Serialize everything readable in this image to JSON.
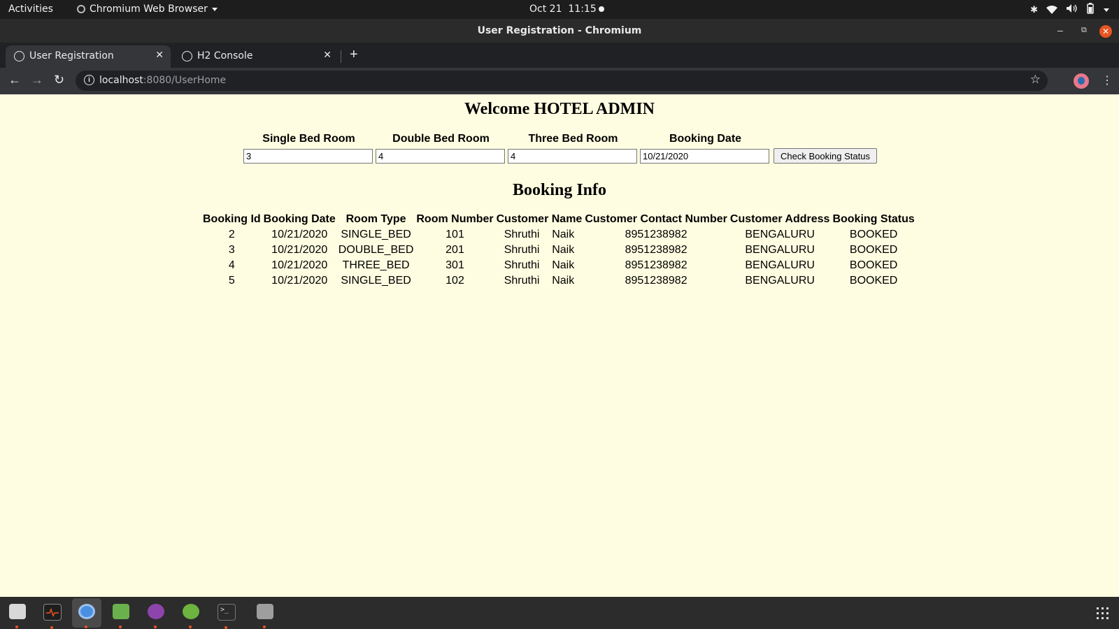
{
  "topbar": {
    "activities": "Activities",
    "app_name": "Chromium Web Browser",
    "date": "Oct 21",
    "time": "11:15"
  },
  "window": {
    "title": "User Registration - Chromium"
  },
  "tabs": [
    {
      "label": "User Registration",
      "active": true
    },
    {
      "label": "H2 Console",
      "active": false
    }
  ],
  "omnibox": {
    "host": "localhost",
    "path": ":8080/UserHome"
  },
  "page": {
    "welcome": "Welcome HOTEL ADMIN",
    "form": {
      "fields": [
        {
          "label": "Single Bed Room",
          "value": "3"
        },
        {
          "label": "Double Bed Room",
          "value": "4"
        },
        {
          "label": "Three Bed Room",
          "value": "4"
        },
        {
          "label": "Booking Date",
          "value": "10/21/2020"
        }
      ],
      "button": "Check Booking Status"
    },
    "booking_title": "Booking Info",
    "table": {
      "columns": [
        "Booking Id",
        "Booking Date",
        "Room Type",
        "Room Number",
        "Customer Name",
        "Customer Contact Number",
        "Customer Address",
        "Booking Status"
      ],
      "rows": [
        {
          "id": "2",
          "date": "10/21/2020",
          "type": "SINGLE_BED",
          "room": "101",
          "first": "Shruthi",
          "last": "Naik",
          "contact": "8951238982",
          "address": "BENGALURU",
          "status": "BOOKED"
        },
        {
          "id": "3",
          "date": "10/21/2020",
          "type": "DOUBLE_BED",
          "room": "201",
          "first": "Shruthi",
          "last": "Naik",
          "contact": "8951238982",
          "address": "BENGALURU",
          "status": "BOOKED"
        },
        {
          "id": "4",
          "date": "10/21/2020",
          "type": "THREE_BED",
          "room": "301",
          "first": "Shruthi",
          "last": "Naik",
          "contact": "8951238982",
          "address": "BENGALURU",
          "status": "BOOKED"
        },
        {
          "id": "5",
          "date": "10/21/2020",
          "type": "SINGLE_BED",
          "room": "102",
          "first": "Shruthi",
          "last": "Naik",
          "contact": "8951238982",
          "address": "BENGALURU",
          "status": "BOOKED"
        }
      ]
    }
  },
  "dock": {
    "apps": [
      "files-icon",
      "system-monitor-icon",
      "chromium-icon",
      "image-editor-icon",
      "github-icon",
      "spring-icon",
      "terminal-icon",
      "disk-icon"
    ],
    "active_app": "chromium-icon"
  },
  "colors": {
    "page_background": "#fffde1",
    "accent": "#e95420"
  }
}
